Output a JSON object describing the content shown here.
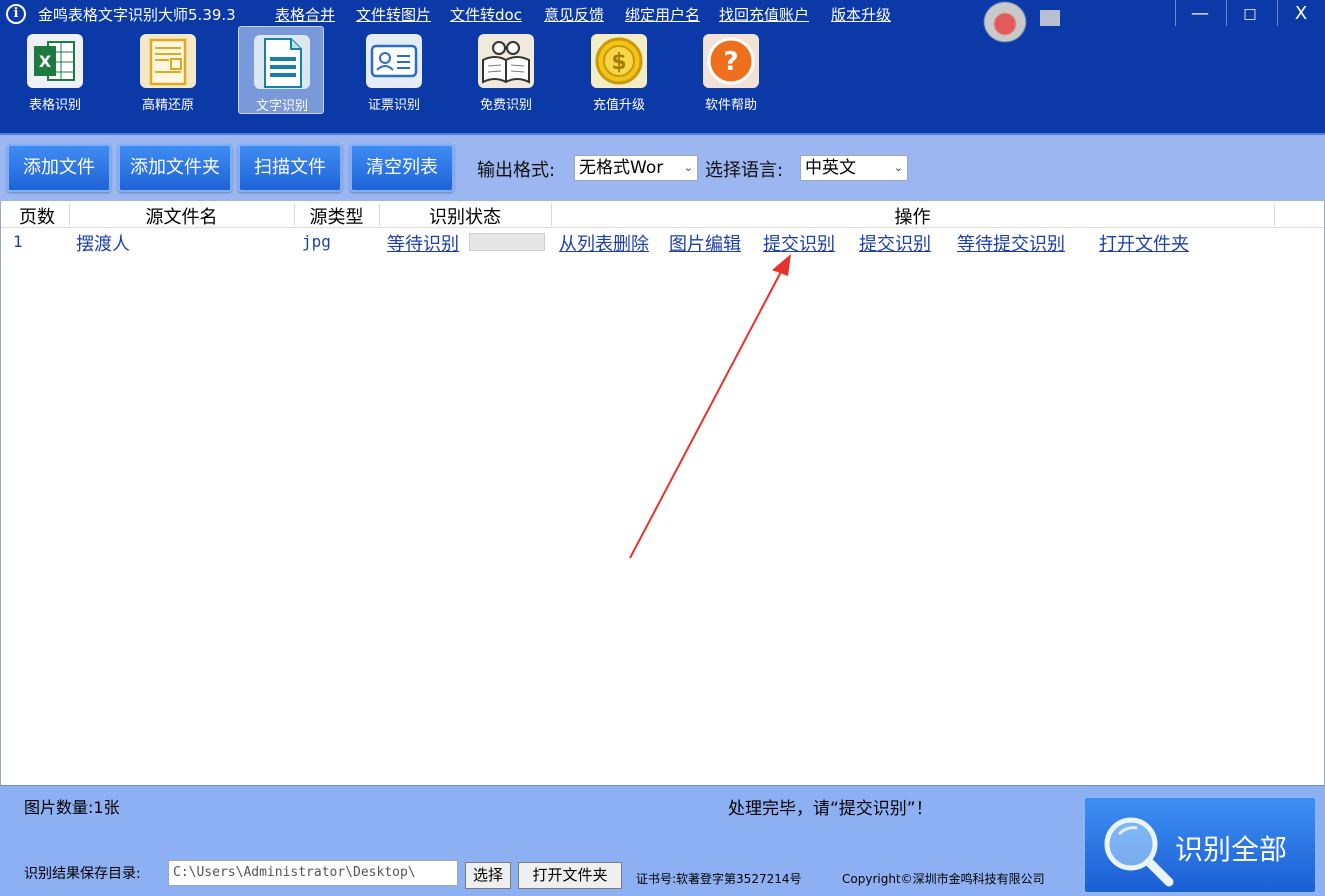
{
  "window": {
    "title": "金鸣表格文字识别大师5.39.3",
    "menu_links": [
      "表格合并",
      "文件转图片",
      "文件转doc",
      "意见反馈",
      "绑定用户名",
      "找回充值账户",
      "版本升级"
    ],
    "controls": {
      "minimize": "—",
      "maximize": "□",
      "close": "X"
    }
  },
  "toolbar": {
    "tools": [
      {
        "label": "表格识别",
        "icon": "excel-icon"
      },
      {
        "label": "高精还原",
        "icon": "document-layout-icon"
      },
      {
        "label": "文字识别",
        "icon": "text-document-icon",
        "active": true
      },
      {
        "label": "证票识别",
        "icon": "id-card-icon"
      },
      {
        "label": "免费识别",
        "icon": "book-glasses-icon"
      },
      {
        "label": "充值升级",
        "icon": "dollar-coin-icon"
      },
      {
        "label": "软件帮助",
        "icon": "help-icon"
      }
    ]
  },
  "actions": {
    "add_file": "添加文件",
    "add_folder": "添加文件夹",
    "scan_file": "扫描文件",
    "clear_list": "清空列表",
    "output_format_label": "输出格式:",
    "output_format_value": "无格式Wor",
    "language_label": "选择语言:",
    "language_value": "中英文"
  },
  "table": {
    "headers": [
      "页数",
      "源文件名",
      "源类型",
      "识别状态",
      "操作"
    ],
    "rows": [
      {
        "page": "1",
        "filename": "摆渡人",
        "type": "jpg",
        "status": "等待识别",
        "progress": 0,
        "ops": [
          "从列表删除",
          "图片编辑",
          "提交识别",
          "提交识别",
          "等待提交识别",
          "打开文件夹"
        ]
      }
    ]
  },
  "footer": {
    "image_count": "图片数量:1张",
    "status_message": "处理完毕，请“提交识别”！",
    "save_dir_label": "识别结果保存目录:",
    "save_dir_value": "C:\\Users\\Administrator\\Desktop\\",
    "choose_button": "选择",
    "open_folder_button": "打开文件夹",
    "cert": "证书号:软著登字第3527214号",
    "copyright": "Copyright©深圳市金鸣科技有限公司",
    "recognize_all": "识别全部"
  },
  "colors": {
    "title_bar": "#0b3aa8",
    "action_bar": "#9bb6f1",
    "button": "#1f63d8",
    "link": "#1c3fb0",
    "annotation_arrow": "#e8322b"
  }
}
